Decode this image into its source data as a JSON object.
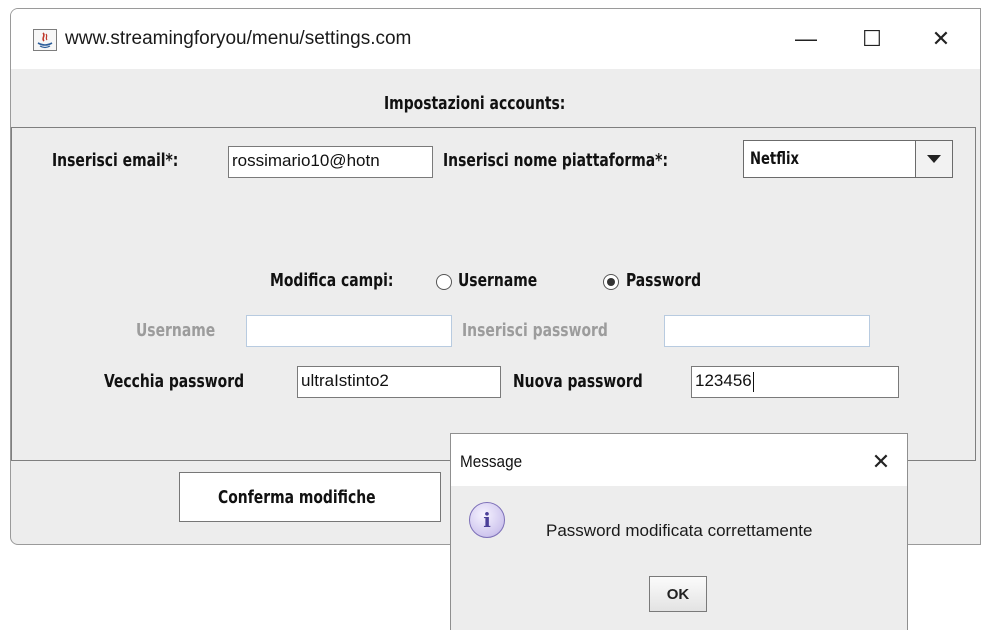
{
  "window": {
    "title": "www.streamingforyou/menu/settings.com",
    "minimize_glyph": "—",
    "maximize_glyph": "☐",
    "close_glyph": "✕"
  },
  "heading": "Impostazioni accounts:",
  "form": {
    "email_label": "Inserisci email*:",
    "email_value": "rossimario10@hotn",
    "platform_label": "Inserisci nome piattaforma*:",
    "platform_value": "Netflix",
    "edit_fields_label": "Modifica campi:",
    "radio_username": "Username",
    "radio_password": "Password",
    "selected_radio": "Password",
    "username_label": "Username",
    "username_value": "",
    "insert_password_label": "Inserisci password",
    "insert_password_value": "",
    "old_password_label": "Vecchia password",
    "old_password_value": "ultraIstinto2",
    "new_password_label": "Nuova password",
    "new_password_value": "123456",
    "confirm_button": "Conferma modifiche"
  },
  "dialog": {
    "title": "Message",
    "close_glyph": "✕",
    "icon": "info-icon",
    "message": "Password modificata correttamente",
    "ok_label": "OK"
  }
}
